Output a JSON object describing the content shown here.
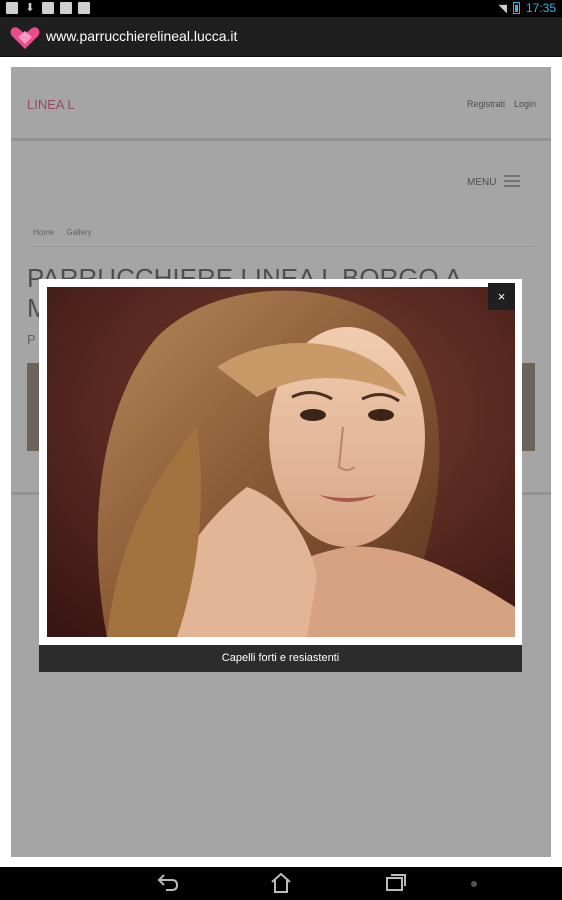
{
  "status_bar": {
    "time": "17:35",
    "left_icons": [
      "gallery-icon",
      "download-icon",
      "sd-card-icon",
      "calendar-icon",
      "check-calendar-icon"
    ],
    "right_icons": [
      "wifi-icon",
      "battery-icon"
    ]
  },
  "app_bar": {
    "url": "www.parrucchierelineal.lucca.it",
    "logo_color": "#e94b8c"
  },
  "site": {
    "title": "LINEA L",
    "nav_links": {
      "register": "Registrati",
      "login": "Login"
    },
    "menu_label": "MENU",
    "breadcrumb": [
      "Home",
      "Gallery"
    ],
    "heading_line1": "PARRUCCHIERE LINEA L BORGO A",
    "heading_line2": "M",
    "subheading": "P"
  },
  "lightbox": {
    "caption": "Capelli forti e resiastenti",
    "close_label": "×"
  },
  "navigation": {
    "icons": [
      "back-icon",
      "home-icon",
      "recent-apps-icon"
    ]
  }
}
